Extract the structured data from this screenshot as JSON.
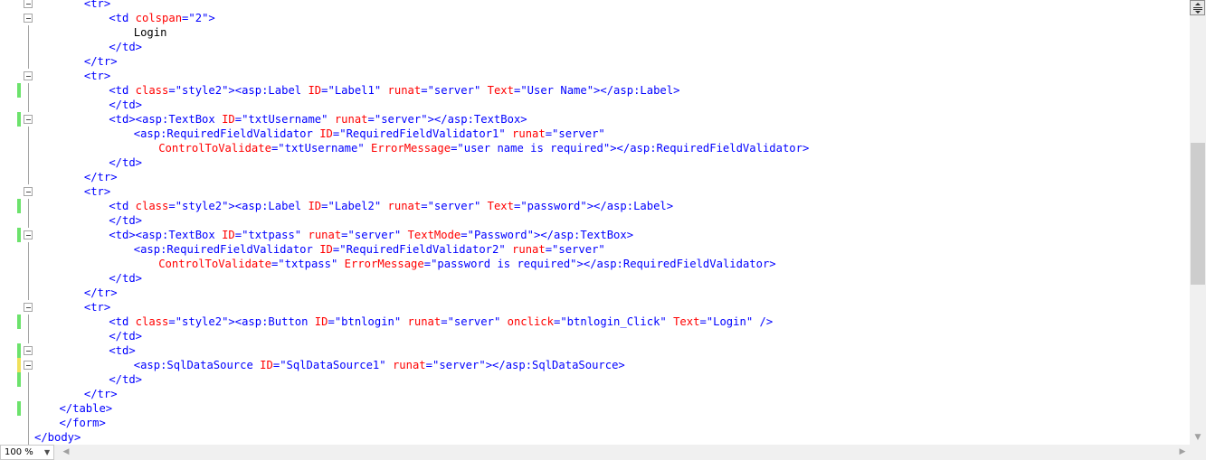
{
  "editor": {
    "zoom": "100 %",
    "lines": [
      {
        "indent": 8,
        "fold": true,
        "change": "none",
        "tokens": [
          [
            "t",
            "<tr>"
          ]
        ]
      },
      {
        "indent": 12,
        "fold": true,
        "change": "none",
        "tokens": [
          [
            "t",
            "<td "
          ],
          [
            "a",
            "colspan"
          ],
          [
            "t",
            "="
          ],
          [
            "v",
            "\"2\""
          ],
          [
            "t",
            ">"
          ]
        ]
      },
      {
        "indent": 16,
        "fold": false,
        "change": "none",
        "tokens": [
          [
            "x",
            "Login"
          ]
        ]
      },
      {
        "indent": 12,
        "fold": false,
        "change": "none",
        "tokens": [
          [
            "t",
            "</td>"
          ]
        ]
      },
      {
        "indent": 8,
        "fold": false,
        "change": "none",
        "tokens": [
          [
            "t",
            "</tr>"
          ]
        ]
      },
      {
        "indent": 8,
        "fold": true,
        "change": "none",
        "tokens": [
          [
            "t",
            "<tr>"
          ]
        ]
      },
      {
        "indent": 12,
        "fold": false,
        "change": "saved",
        "tokens": [
          [
            "t",
            "<td "
          ],
          [
            "a",
            "class"
          ],
          [
            "t",
            "="
          ],
          [
            "v",
            "\"style2\""
          ],
          [
            "t",
            "><asp:Label "
          ],
          [
            "a",
            "ID"
          ],
          [
            "t",
            "="
          ],
          [
            "v",
            "\"Label1\""
          ],
          [
            "t",
            " "
          ],
          [
            "a",
            "runat"
          ],
          [
            "t",
            "="
          ],
          [
            "v",
            "\"server\""
          ],
          [
            "t",
            " "
          ],
          [
            "a",
            "Text"
          ],
          [
            "t",
            "="
          ],
          [
            "v",
            "\"User Name\""
          ],
          [
            "t",
            "></asp:Label>"
          ]
        ]
      },
      {
        "indent": 12,
        "fold": false,
        "change": "none",
        "tokens": [
          [
            "t",
            "</td>"
          ]
        ]
      },
      {
        "indent": 12,
        "fold": true,
        "change": "saved",
        "tokens": [
          [
            "t",
            "<td><asp:TextBox "
          ],
          [
            "a",
            "ID"
          ],
          [
            "t",
            "="
          ],
          [
            "v",
            "\"txtUsername\""
          ],
          [
            "t",
            " "
          ],
          [
            "a",
            "runat"
          ],
          [
            "t",
            "="
          ],
          [
            "v",
            "\"server\""
          ],
          [
            "t",
            "></asp:TextBox>"
          ]
        ]
      },
      {
        "indent": 16,
        "fold": false,
        "change": "none",
        "tokens": [
          [
            "t",
            "<asp:RequiredFieldValidator "
          ],
          [
            "a",
            "ID"
          ],
          [
            "t",
            "="
          ],
          [
            "v",
            "\"RequiredFieldValidator1\""
          ],
          [
            "t",
            " "
          ],
          [
            "a",
            "runat"
          ],
          [
            "t",
            "="
          ],
          [
            "v",
            "\"server\""
          ]
        ]
      },
      {
        "indent": 20,
        "fold": false,
        "change": "none",
        "tokens": [
          [
            "a",
            "ControlToValidate"
          ],
          [
            "t",
            "="
          ],
          [
            "v",
            "\"txtUsername\""
          ],
          [
            "t",
            " "
          ],
          [
            "a",
            "ErrorMessage"
          ],
          [
            "t",
            "="
          ],
          [
            "v",
            "\"user name is required\""
          ],
          [
            "t",
            "></asp:RequiredFieldValidator>"
          ]
        ]
      },
      {
        "indent": 12,
        "fold": false,
        "change": "none",
        "tokens": [
          [
            "t",
            "</td>"
          ]
        ]
      },
      {
        "indent": 8,
        "fold": false,
        "change": "none",
        "tokens": [
          [
            "t",
            "</tr>"
          ]
        ]
      },
      {
        "indent": 8,
        "fold": true,
        "change": "none",
        "tokens": [
          [
            "t",
            "<tr>"
          ]
        ]
      },
      {
        "indent": 12,
        "fold": false,
        "change": "saved",
        "tokens": [
          [
            "t",
            "<td "
          ],
          [
            "a",
            "class"
          ],
          [
            "t",
            "="
          ],
          [
            "v",
            "\"style2\""
          ],
          [
            "t",
            "><asp:Label "
          ],
          [
            "a",
            "ID"
          ],
          [
            "t",
            "="
          ],
          [
            "v",
            "\"Label2\""
          ],
          [
            "t",
            " "
          ],
          [
            "a",
            "runat"
          ],
          [
            "t",
            "="
          ],
          [
            "v",
            "\"server\""
          ],
          [
            "t",
            " "
          ],
          [
            "a",
            "Text"
          ],
          [
            "t",
            "="
          ],
          [
            "v",
            "\"password\""
          ],
          [
            "t",
            "></asp:Label>"
          ]
        ]
      },
      {
        "indent": 12,
        "fold": false,
        "change": "none",
        "tokens": [
          [
            "t",
            "</td>"
          ]
        ]
      },
      {
        "indent": 12,
        "fold": true,
        "change": "saved",
        "tokens": [
          [
            "t",
            "<td><asp:TextBox "
          ],
          [
            "a",
            "ID"
          ],
          [
            "t",
            "="
          ],
          [
            "v",
            "\"txtpass\""
          ],
          [
            "t",
            " "
          ],
          [
            "a",
            "runat"
          ],
          [
            "t",
            "="
          ],
          [
            "v",
            "\"server\""
          ],
          [
            "t",
            " "
          ],
          [
            "a",
            "TextMode"
          ],
          [
            "t",
            "="
          ],
          [
            "v",
            "\"Password\""
          ],
          [
            "t",
            "></asp:TextBox>"
          ]
        ]
      },
      {
        "indent": 16,
        "fold": false,
        "change": "none",
        "tokens": [
          [
            "t",
            "<asp:RequiredFieldValidator "
          ],
          [
            "a",
            "ID"
          ],
          [
            "t",
            "="
          ],
          [
            "v",
            "\"RequiredFieldValidator2\""
          ],
          [
            "t",
            " "
          ],
          [
            "a",
            "runat"
          ],
          [
            "t",
            "="
          ],
          [
            "v",
            "\"server\""
          ]
        ]
      },
      {
        "indent": 20,
        "fold": false,
        "change": "none",
        "tokens": [
          [
            "a",
            "ControlToValidate"
          ],
          [
            "t",
            "="
          ],
          [
            "v",
            "\"txtpass\""
          ],
          [
            "t",
            " "
          ],
          [
            "a",
            "ErrorMessage"
          ],
          [
            "t",
            "="
          ],
          [
            "v",
            "\"password is required\""
          ],
          [
            "t",
            "></asp:RequiredFieldValidator>"
          ]
        ]
      },
      {
        "indent": 12,
        "fold": false,
        "change": "none",
        "tokens": [
          [
            "t",
            "</td>"
          ]
        ]
      },
      {
        "indent": 8,
        "fold": false,
        "change": "none",
        "tokens": [
          [
            "t",
            "</tr>"
          ]
        ]
      },
      {
        "indent": 8,
        "fold": true,
        "change": "none",
        "tokens": [
          [
            "t",
            "<tr>"
          ]
        ]
      },
      {
        "indent": 12,
        "fold": false,
        "change": "saved",
        "tokens": [
          [
            "t",
            "<td "
          ],
          [
            "a",
            "class"
          ],
          [
            "t",
            "="
          ],
          [
            "v",
            "\"style2\""
          ],
          [
            "t",
            "><asp:Button "
          ],
          [
            "a",
            "ID"
          ],
          [
            "t",
            "="
          ],
          [
            "v",
            "\"btnlogin\""
          ],
          [
            "t",
            " "
          ],
          [
            "a",
            "runat"
          ],
          [
            "t",
            "="
          ],
          [
            "v",
            "\"server\""
          ],
          [
            "t",
            " "
          ],
          [
            "a",
            "onclick"
          ],
          [
            "t",
            "="
          ],
          [
            "v",
            "\"btnlogin_Click\""
          ],
          [
            "t",
            " "
          ],
          [
            "a",
            "Text"
          ],
          [
            "t",
            "="
          ],
          [
            "v",
            "\"Login\""
          ],
          [
            "t",
            " />"
          ]
        ]
      },
      {
        "indent": 12,
        "fold": false,
        "change": "none",
        "tokens": [
          [
            "t",
            "</td>"
          ]
        ]
      },
      {
        "indent": 12,
        "fold": true,
        "change": "saved",
        "tokens": [
          [
            "t",
            "<td>"
          ]
        ]
      },
      {
        "indent": 16,
        "fold": true,
        "change": "unsaved",
        "tokens": [
          [
            "t",
            "<asp:SqlDataSource "
          ],
          [
            "a",
            "ID"
          ],
          [
            "t",
            "="
          ],
          [
            "v",
            "\"SqlDataSource1\""
          ],
          [
            "t",
            " "
          ],
          [
            "a",
            "runat"
          ],
          [
            "t",
            "="
          ],
          [
            "v",
            "\"server\""
          ],
          [
            "t",
            "></asp:SqlDataSource>"
          ]
        ]
      },
      {
        "indent": 12,
        "fold": false,
        "change": "saved",
        "tokens": [
          [
            "t",
            "</td>"
          ]
        ]
      },
      {
        "indent": 8,
        "fold": false,
        "change": "none",
        "tokens": [
          [
            "t",
            "</tr>"
          ]
        ]
      },
      {
        "indent": 4,
        "fold": false,
        "change": "saved",
        "tokens": [
          [
            "t",
            "</table>"
          ]
        ]
      },
      {
        "indent": 4,
        "fold": false,
        "change": "none",
        "tokens": [
          [
            "t",
            "</form>"
          ]
        ]
      },
      {
        "indent": 0,
        "fold": false,
        "change": "none",
        "tokens": [
          [
            "t",
            "</body>"
          ]
        ]
      }
    ]
  },
  "icons": {
    "split": "split-window-icon",
    "scroll_down": "arrow-down-icon",
    "scroll_left": "arrow-left-icon",
    "scroll_right": "arrow-right-icon",
    "zoom_dropdown": "dropdown-arrow-icon"
  },
  "colors": {
    "tag": "#0000ff",
    "attribute": "#ff0000",
    "value": "#0000ff",
    "text": "#000000",
    "change_saved": "#6ce26c",
    "change_unsaved": "#f0e05a"
  }
}
